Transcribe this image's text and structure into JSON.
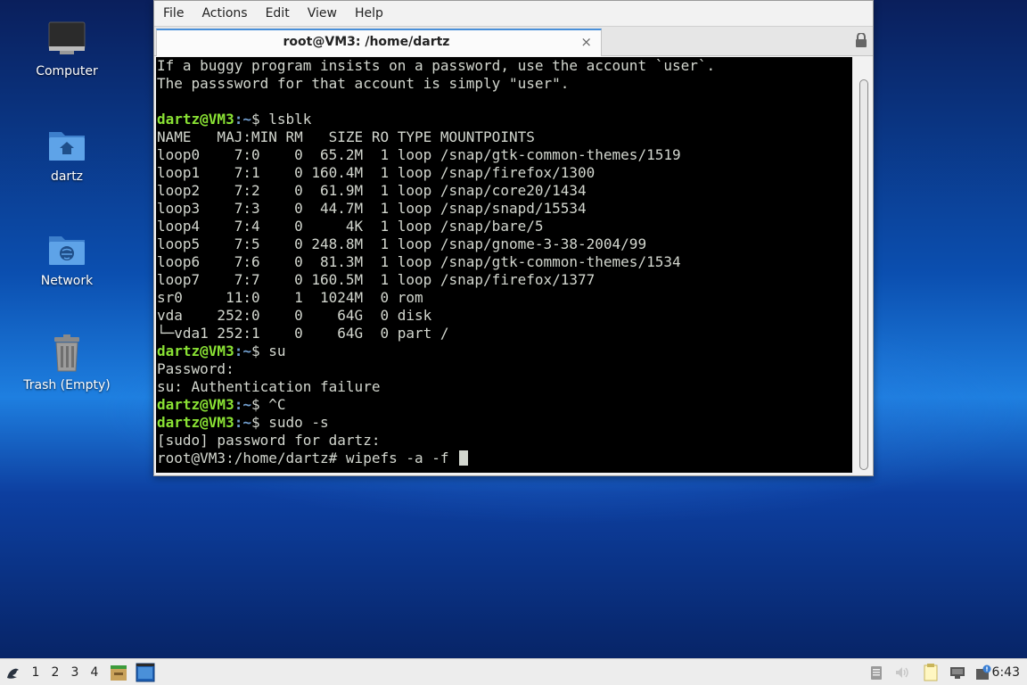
{
  "desktop": {
    "icons": [
      {
        "label": "Computer",
        "icon": "computer-icon"
      },
      {
        "label": "dartz",
        "icon": "home-folder-icon"
      },
      {
        "label": "Network",
        "icon": "network-folder-icon"
      },
      {
        "label": "Trash (Empty)",
        "icon": "trash-icon"
      }
    ]
  },
  "window": {
    "menu": [
      "File",
      "Actions",
      "Edit",
      "View",
      "Help"
    ],
    "tab_title": "root@VM3: /home/dartz",
    "tab_close": "×",
    "lock_icon": "lock-icon"
  },
  "terminal": {
    "lines": [
      "If a buggy program insists on a password, use the account `user`.",
      "The passsword for that account is simply \"user\".",
      "",
      {
        "user": "dartz@VM3",
        "path": ":~",
        "cmd": "$ lsblk"
      },
      "NAME   MAJ:MIN RM   SIZE RO TYPE MOUNTPOINTS",
      "loop0    7:0    0  65.2M  1 loop /snap/gtk-common-themes/1519",
      "loop1    7:1    0 160.4M  1 loop /snap/firefox/1300",
      "loop2    7:2    0  61.9M  1 loop /snap/core20/1434",
      "loop3    7:3    0  44.7M  1 loop /snap/snapd/15534",
      "loop4    7:4    0     4K  1 loop /snap/bare/5",
      "loop5    7:5    0 248.8M  1 loop /snap/gnome-3-38-2004/99",
      "loop6    7:6    0  81.3M  1 loop /snap/gtk-common-themes/1534",
      "loop7    7:7    0 160.5M  1 loop /snap/firefox/1377",
      "sr0     11:0    1  1024M  0 rom",
      "vda    252:0    0    64G  0 disk",
      "└─vda1 252:1    0    64G  0 part /",
      {
        "user": "dartz@VM3",
        "path": ":~",
        "cmd": "$ su"
      },
      "Password:",
      "su: Authentication failure",
      {
        "user": "dartz@VM3",
        "path": ":~",
        "cmd": "$ ^C"
      },
      {
        "user": "dartz@VM3",
        "path": ":~",
        "cmd": "$ sudo -s"
      },
      "[sudo] password for dartz:",
      "root@VM3:/home/dartz# wipefs -a -f "
    ]
  },
  "panel": {
    "workspaces": [
      "1",
      "2",
      "3",
      "4"
    ],
    "clock": "6:43",
    "icons": [
      "menu-icon",
      "file-manager-icon",
      "terminal-taskbar-icon",
      "clipboard-icon",
      "volume-icon",
      "notes-icon",
      "network-tray-icon",
      "updates-icon"
    ]
  },
  "colors": {
    "prompt_user": "#8ae234",
    "prompt_path": "#729fcf",
    "terminal_bg": "#000000",
    "terminal_fg": "#d3d7cf"
  }
}
